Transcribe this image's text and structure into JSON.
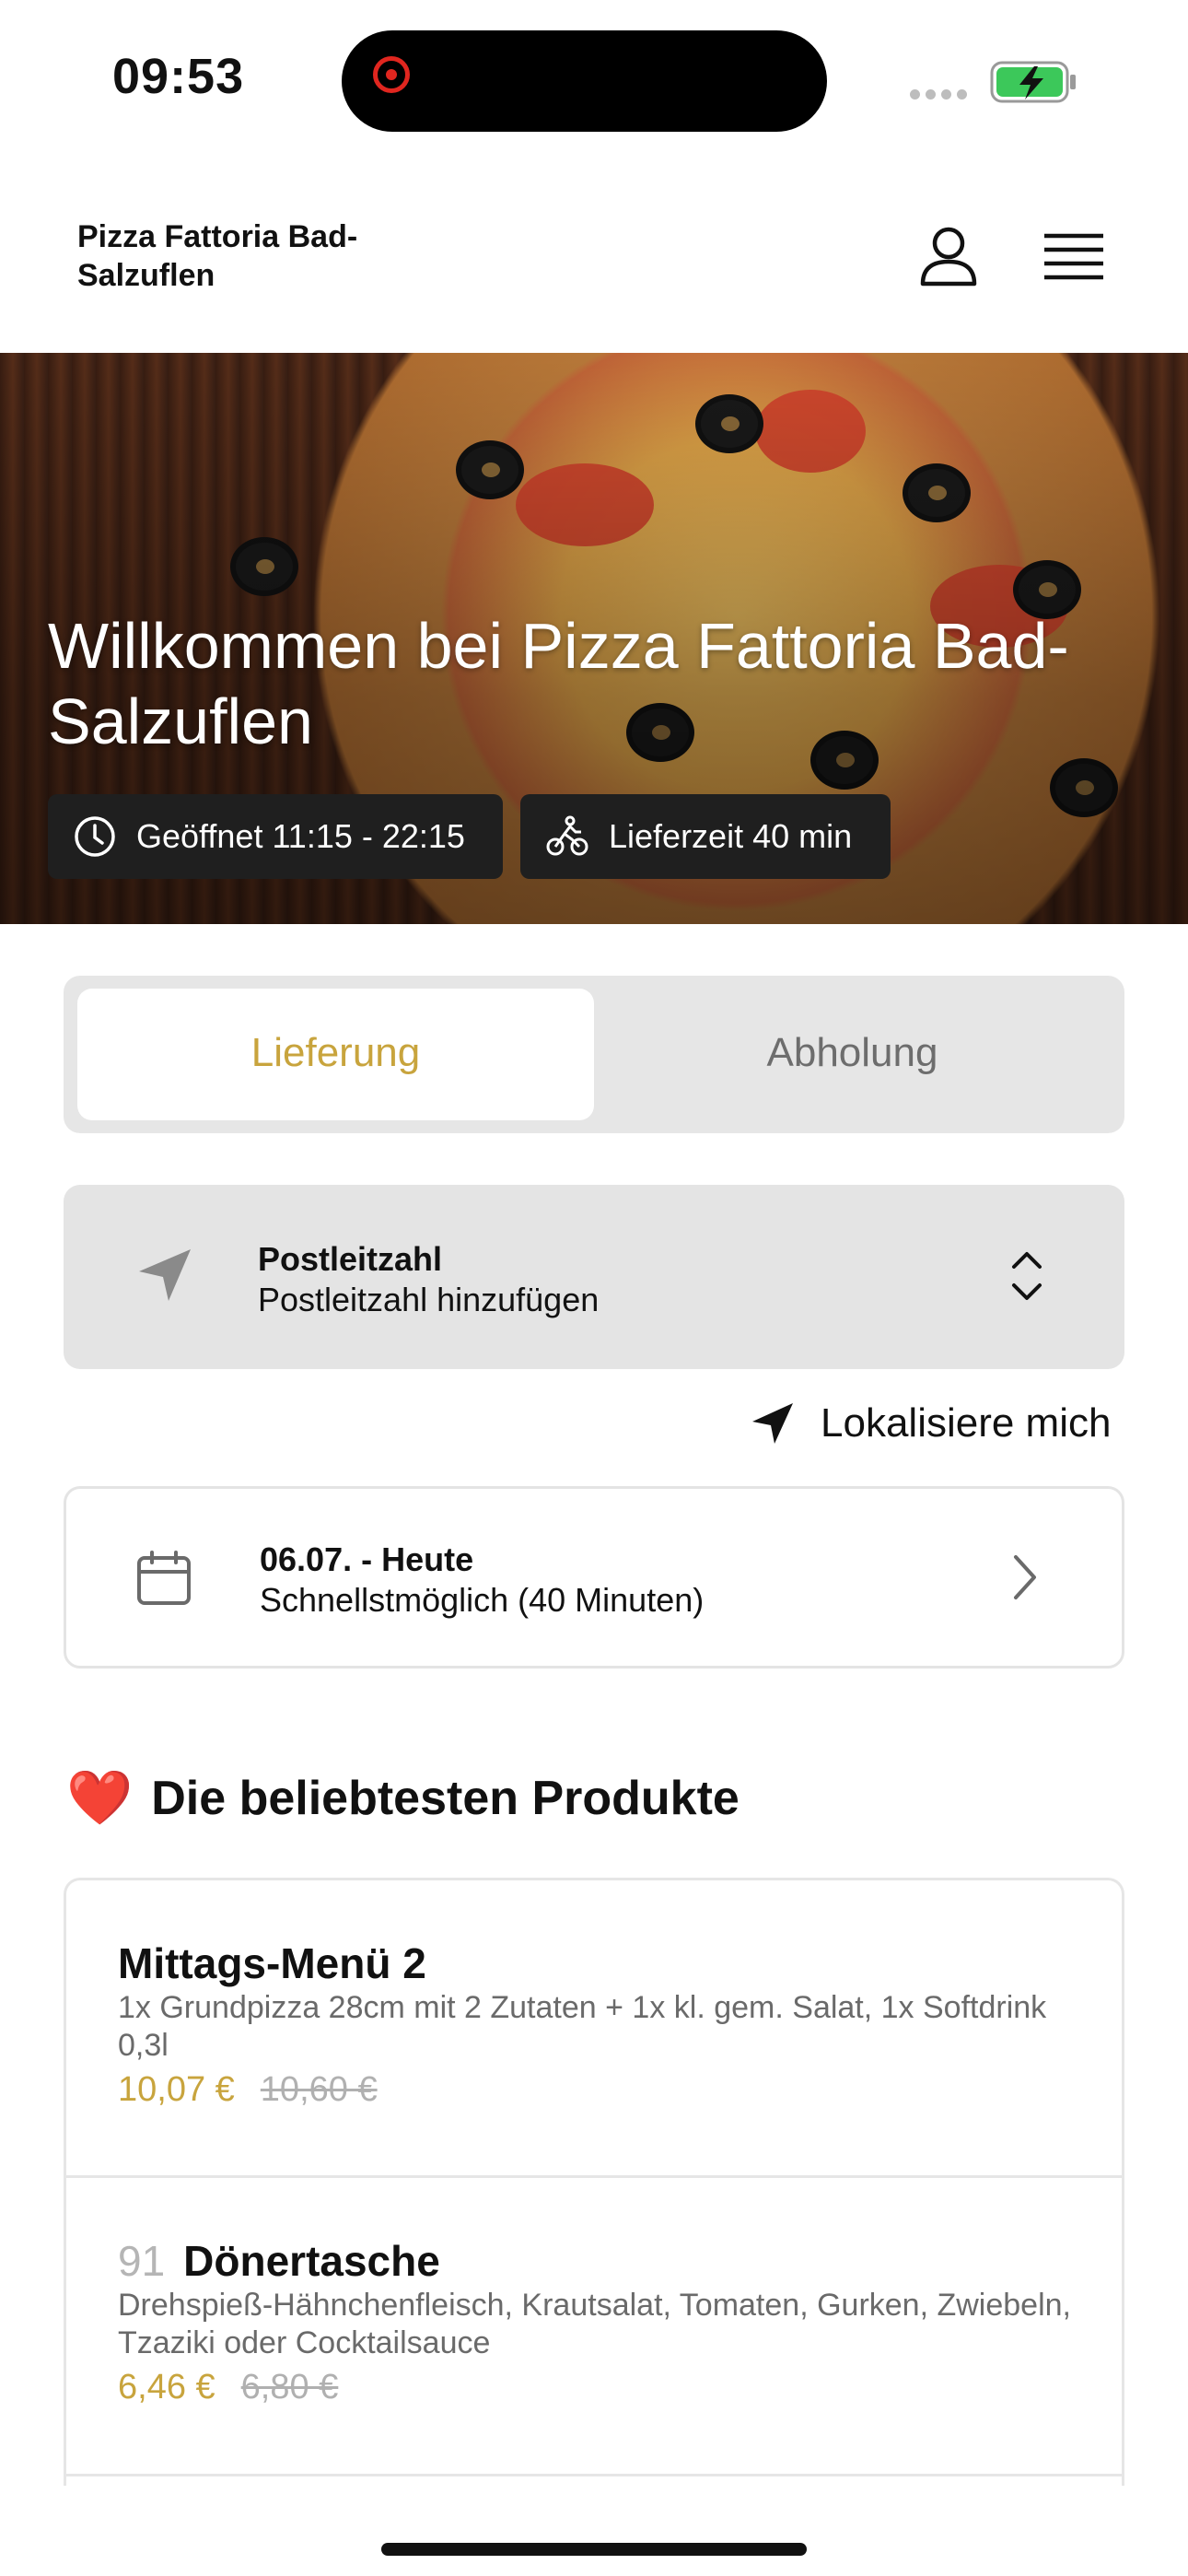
{
  "status_bar": {
    "time": "09:53",
    "icons": [
      "screen-recording-icon",
      "signal-icon",
      "battery-charging-icon"
    ]
  },
  "header": {
    "brand": "Pizza Fattoria Bad-Salzuflen",
    "icons": [
      "user-icon",
      "menu-icon"
    ]
  },
  "hero": {
    "title": "Willkommen bei Pizza Fattoria Bad-Salzuflen",
    "open_hours": "Geöffnet 11:15 - 22:15",
    "delivery_time": "Lieferzeit 40 min",
    "icons": [
      "clock-icon",
      "bike-icon"
    ]
  },
  "order_mode": {
    "options": [
      "Lieferung",
      "Abholung"
    ],
    "selected": "Lieferung"
  },
  "postcode": {
    "label": "Postleitzahl",
    "placeholder": "Postleitzahl hinzufügen"
  },
  "locate_me": "Lokalisiere mich",
  "delivery_date": {
    "date": "06.07. - Heute",
    "time": "Schnellstmöglich (40 Minuten)"
  },
  "popular": {
    "emoji": "❤️",
    "title": "Die beliebtesten Produkte",
    "products": [
      {
        "number": "",
        "name": "Mittags-Menü 2",
        "description": "1x Grundpizza 28cm mit 2 Zutaten + 1x kl. gem. Salat, 1x Softdrink 0,3l",
        "price": "10,07 €",
        "old_price": "10,60 €"
      },
      {
        "number": "91",
        "name": "Dönertasche",
        "description": "Drehspieß-Hähnchenfleisch, Krautsalat, Tomaten, Gurken, Zwiebeln, Tzaziki oder Cocktailsauce",
        "price": "6,46 €",
        "old_price": "6,80 €"
      }
    ]
  },
  "colors": {
    "accent": "#c8a43d",
    "pill_bg": "#1f1f1f",
    "input_bg": "#e4e4e4"
  }
}
